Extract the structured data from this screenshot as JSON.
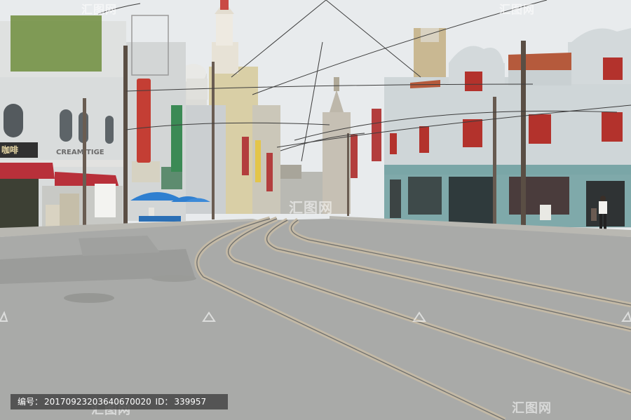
{
  "image": {
    "description_free": true
  },
  "signs": {
    "cafe_chinese": "咖啡",
    "cream_sign": "CREAM TIGE"
  },
  "watermark": {
    "text": "汇图网",
    "id_label": "编号：",
    "id_value": "20170923203640670020",
    "extra_label": "ID：",
    "extra_value": "339957"
  },
  "colors": {
    "sky": "#e7eaec",
    "road": "#a9aaa8",
    "building_left": "#d9dcdc",
    "building_right": "#cfd6d8",
    "trim_teal": "#7aa6a7",
    "awning_red": "#b8303a",
    "window_red": "#b3322c",
    "umbrella_blue": "#2f7fd0"
  }
}
